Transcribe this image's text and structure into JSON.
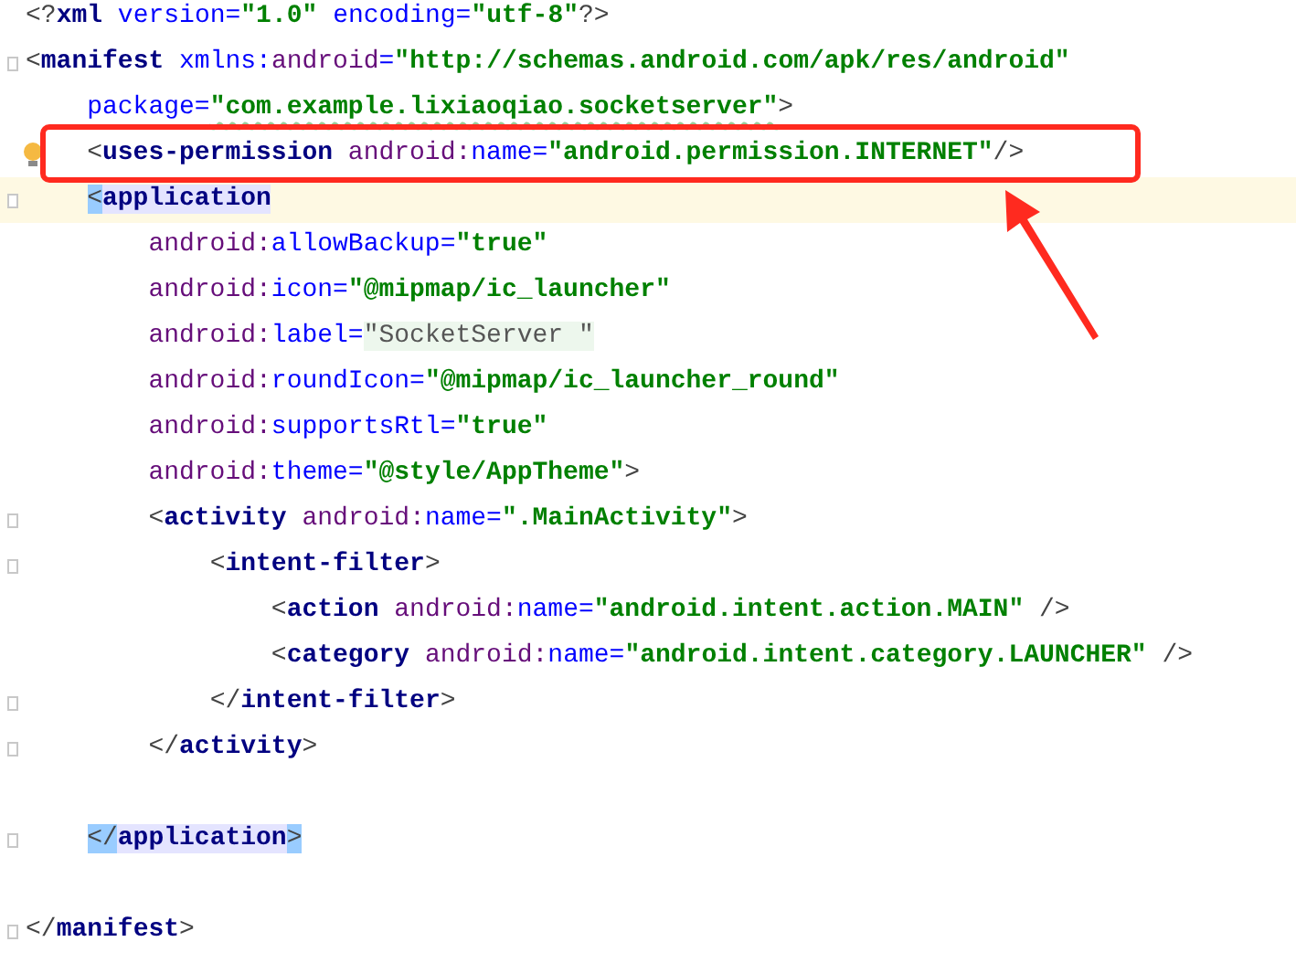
{
  "editor": {
    "lines": [
      {
        "kind": "code",
        "current": false,
        "fold": false,
        "bulb": false,
        "tokens": [
          {
            "kind": "punct",
            "text": "<?"
          },
          {
            "kind": "tag",
            "text": "xml"
          },
          {
            "kind": "attr",
            "text": " version="
          },
          {
            "kind": "value",
            "text": "\"1.0\""
          },
          {
            "kind": "attr",
            "text": " encoding="
          },
          {
            "kind": "value",
            "text": "\"utf-8\""
          },
          {
            "kind": "punct",
            "text": "?>"
          }
        ]
      },
      {
        "kind": "code",
        "current": false,
        "fold": true,
        "bulb": false,
        "tokens": [
          {
            "kind": "punct",
            "text": "<"
          },
          {
            "kind": "tag",
            "text": "manifest "
          },
          {
            "kind": "attr",
            "text": "xmlns:"
          },
          {
            "kind": "ns",
            "text": "android"
          },
          {
            "kind": "attr",
            "text": "="
          },
          {
            "kind": "value",
            "text": "\"http://schemas.android.com/apk/res/android\""
          }
        ],
        "children": [
          {
            "kind": "code",
            "current": false,
            "fold": false,
            "bulb": false,
            "tokens": [
              {
                "kind": "attr",
                "text": "package="
              },
              {
                "kind": "value",
                "text": "\"com.example.lixiaoqiao.socketserver\"",
                "typo": true
              },
              {
                "kind": "punct",
                "text": ">"
              }
            ]
          },
          {
            "kind": "code",
            "current": false,
            "fold": false,
            "bulb": true,
            "tokens": [
              {
                "kind": "punct",
                "text": "<"
              },
              {
                "kind": "tag",
                "text": "uses-permission "
              },
              {
                "kind": "ns",
                "text": "android:"
              },
              {
                "kind": "attr",
                "text": "name="
              },
              {
                "kind": "value",
                "text": "\"android.permission.INTERNET\""
              },
              {
                "kind": "punct",
                "text": "/>"
              }
            ]
          },
          {
            "kind": "code",
            "current": true,
            "fold": true,
            "bulb": false,
            "tokens": [
              {
                "kind": "punct",
                "text": "<",
                "highlight": true
              },
              {
                "kind": "tag",
                "text": "application",
                "highlight": true
              }
            ],
            "children": [
              {
                "kind": "code",
                "current": false,
                "fold": false,
                "bulb": false,
                "tokens": [
                  {
                    "kind": "ns",
                    "text": "android:"
                  },
                  {
                    "kind": "attr",
                    "text": "allowBackup="
                  },
                  {
                    "kind": "value",
                    "text": "\"true\""
                  }
                ]
              },
              {
                "kind": "code",
                "current": false,
                "fold": false,
                "bulb": false,
                "tokens": [
                  {
                    "kind": "ns",
                    "text": "android:"
                  },
                  {
                    "kind": "attr",
                    "text": "icon="
                  },
                  {
                    "kind": "value",
                    "text": "\"@mipmap/ic_launcher\""
                  }
                ]
              },
              {
                "kind": "code",
                "current": false,
                "fold": false,
                "bulb": false,
                "tokens": [
                  {
                    "kind": "ns",
                    "text": "android:"
                  },
                  {
                    "kind": "attr",
                    "text": "label="
                  },
                  {
                    "kind": "literal",
                    "text": "\"SocketServer \"",
                    "highlight": true
                  }
                ]
              },
              {
                "kind": "code",
                "current": false,
                "fold": false,
                "bulb": false,
                "tokens": [
                  {
                    "kind": "ns",
                    "text": "android:"
                  },
                  {
                    "kind": "attr",
                    "text": "roundIcon="
                  },
                  {
                    "kind": "value",
                    "text": "\"@mipmap/ic_launcher_round\""
                  }
                ]
              },
              {
                "kind": "code",
                "current": false,
                "fold": false,
                "bulb": false,
                "tokens": [
                  {
                    "kind": "ns",
                    "text": "android:"
                  },
                  {
                    "kind": "attr",
                    "text": "supportsRtl="
                  },
                  {
                    "kind": "value",
                    "text": "\"true\""
                  }
                ]
              },
              {
                "kind": "code",
                "current": false,
                "fold": false,
                "bulb": false,
                "tokens": [
                  {
                    "kind": "ns",
                    "text": "android:"
                  },
                  {
                    "kind": "attr",
                    "text": "theme="
                  },
                  {
                    "kind": "value",
                    "text": "\"@style/AppTheme\""
                  },
                  {
                    "kind": "punct",
                    "text": ">"
                  }
                ]
              },
              {
                "kind": "code",
                "current": false,
                "fold": true,
                "bulb": false,
                "tokens": [
                  {
                    "kind": "punct",
                    "text": "<"
                  },
                  {
                    "kind": "tag",
                    "text": "activity "
                  },
                  {
                    "kind": "ns",
                    "text": "android:"
                  },
                  {
                    "kind": "attr",
                    "text": "name="
                  },
                  {
                    "kind": "value",
                    "text": "\".MainActivity\""
                  },
                  {
                    "kind": "punct",
                    "text": ">"
                  }
                ],
                "children": [
                  {
                    "kind": "code",
                    "current": false,
                    "fold": true,
                    "bulb": false,
                    "tokens": [
                      {
                        "kind": "punct",
                        "text": "<"
                      },
                      {
                        "kind": "tag",
                        "text": "intent-filter"
                      },
                      {
                        "kind": "punct",
                        "text": ">"
                      }
                    ],
                    "children": [
                      {
                        "kind": "code",
                        "current": false,
                        "fold": false,
                        "bulb": false,
                        "tokens": [
                          {
                            "kind": "punct",
                            "text": "<"
                          },
                          {
                            "kind": "tag",
                            "text": "action "
                          },
                          {
                            "kind": "ns",
                            "text": "android:"
                          },
                          {
                            "kind": "attr",
                            "text": "name="
                          },
                          {
                            "kind": "value",
                            "text": "\"android.intent.action.MAIN\""
                          },
                          {
                            "kind": "punct",
                            "text": " />"
                          }
                        ]
                      },
                      {
                        "kind": "code",
                        "current": false,
                        "fold": false,
                        "bulb": false,
                        "tokens": [
                          {
                            "kind": "punct",
                            "text": "<"
                          },
                          {
                            "kind": "tag",
                            "text": "category "
                          },
                          {
                            "kind": "ns",
                            "text": "android:"
                          },
                          {
                            "kind": "attr",
                            "text": "name="
                          },
                          {
                            "kind": "value",
                            "text": "\"android.intent.category.LAUNCHER\""
                          },
                          {
                            "kind": "punct",
                            "text": " />"
                          }
                        ]
                      }
                    ]
                  },
                  {
                    "kind": "code",
                    "current": false,
                    "fold": true,
                    "bulb": false,
                    "tokens": [
                      {
                        "kind": "punct",
                        "text": "</"
                      },
                      {
                        "kind": "tag",
                        "text": "intent-filter"
                      },
                      {
                        "kind": "punct",
                        "text": ">"
                      }
                    ]
                  }
                ]
              },
              {
                "kind": "code",
                "current": false,
                "fold": true,
                "bulb": false,
                "tokens": [
                  {
                    "kind": "punct",
                    "text": "</"
                  },
                  {
                    "kind": "tag",
                    "text": "activity"
                  },
                  {
                    "kind": "punct",
                    "text": ">"
                  }
                ]
              }
            ]
          },
          {
            "kind": "blank"
          },
          {
            "kind": "code",
            "current": false,
            "fold": true,
            "bulb": false,
            "tokens": [
              {
                "kind": "punct",
                "text": "</",
                "highlight": true
              },
              {
                "kind": "tag",
                "text": "application",
                "highlight": true
              },
              {
                "kind": "punct",
                "text": ">",
                "highlight": true
              }
            ]
          }
        ]
      },
      {
        "kind": "blank"
      },
      {
        "kind": "code",
        "current": false,
        "fold": true,
        "bulb": false,
        "tokens": [
          {
            "kind": "punct",
            "text": "</"
          },
          {
            "kind": "tag",
            "text": "manifest"
          },
          {
            "kind": "punct",
            "text": ">"
          }
        ]
      }
    ]
  }
}
